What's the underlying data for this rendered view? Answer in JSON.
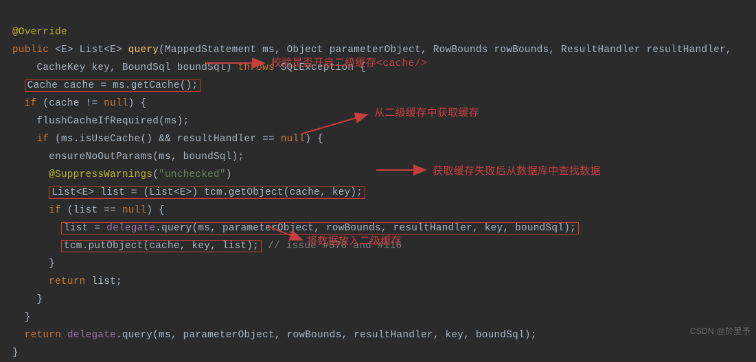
{
  "code": {
    "override": "@Override",
    "public": "public",
    "generic1": "<E> List<E>",
    "query": " query",
    "params_open": "(MappedStatement ms, Object parameterObject, RowBounds rowBounds, ResultHandler resultHandler,",
    "params_line2": "CacheKey key, BoundSql boundSql)",
    "throws": " throws",
    "exception": " SQLException {",
    "line_cache_get": "Cache cache = ms.getCache();",
    "if_cache": "if",
    "if_cache_cond": " (cache != ",
    "null1": "null",
    "if_cache_close": ") {",
    "flush_call": "flushCacheIfRequired(ms);",
    "if_use": "if",
    "if_use_cond": " (ms.isUseCache() && resultHandler == ",
    "null2": "null",
    "if_use_close": ") {",
    "ensure": "ensureNoOutParams(ms, boundSql);",
    "supp_ann": "@SuppressWarnings",
    "supp_arg_open": "(",
    "supp_str": "\"unchecked\"",
    "supp_arg_close": ")",
    "list_decl": "List<E> list = (List<E>) tcm.getObject(cache, key);",
    "if_list": "if",
    "if_list_cond": " (list == ",
    "null3": "null",
    "if_list_close": ") {",
    "delegate_line": "list = delegate.query(ms, parameterObject, rowBounds, resultHandler, key, boundSql);",
    "delegate_word": "delegate",
    "put_line": "tcm.putObject(cache, key, list);",
    "put_comment": " // issue #578 and #116",
    "brace1": "}",
    "return_kw": "return",
    "return_list": " list;",
    "brace2": "}",
    "brace3": "}",
    "return_kw2": "return",
    "last_return": " delegate.query(ms, parameterObject, rowBounds, resultHandler, key, boundSql);",
    "brace4": "}"
  },
  "annotations": {
    "a1": "校验是否开启二级缓存<cache/>",
    "a2": "从二级缓存中获取缓存",
    "a3": "获取缓存失败后从数据库中查找数据",
    "a4": "将数据放入二级缓存"
  },
  "watermark": "CSDN @於里予"
}
